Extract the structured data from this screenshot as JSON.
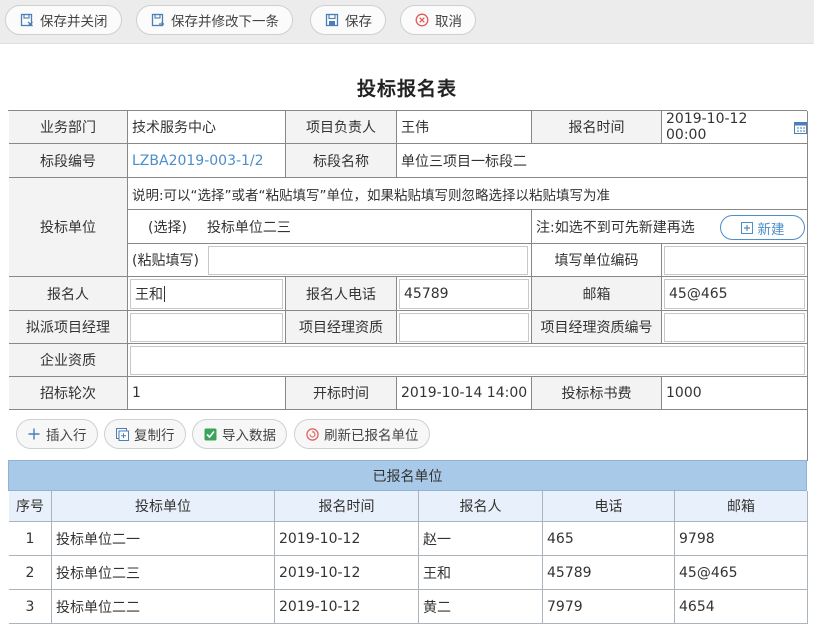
{
  "toolbar": {
    "save_close": "保存并关闭",
    "save_next": "保存并修改下一条",
    "save": "保存",
    "cancel": "取消"
  },
  "form": {
    "title": "投标报名表",
    "dept_label": "业务部门",
    "dept_value": "技术服务中心",
    "pm_label": "项目负责人",
    "pm_value": "王伟",
    "reg_time_label": "报名时间",
    "reg_time_value": "2019-10-12 00:00",
    "section_no_label": "标段编号",
    "section_no_value": "LZBA2019-003-1/2",
    "section_name_label": "标段名称",
    "section_name_value": "单位三项目一标段二",
    "bidder_label": "投标单位",
    "bidder_note": "说明:可以“选择”或者“粘贴填写”单位，如果粘贴填写则忽略选择以粘贴填写为准",
    "select_label": "(选择)",
    "select_value": "投标单位二三",
    "new_hint": "注:如选不到可先新建再选",
    "new_button": "新建",
    "paste_label": "(粘贴填写)",
    "paste_value": "",
    "unit_code_label": "填写单位编码",
    "unit_code_value": "",
    "applicant_label": "报名人",
    "applicant_value": "王和",
    "phone_label": "报名人电话",
    "phone_value": "45789",
    "email_label": "邮箱",
    "email_value": "45@465",
    "manager_label": "拟派项目经理",
    "manager_value": "",
    "manager_qual_label": "项目经理资质",
    "manager_qual_value": "",
    "manager_qual_no_label": "项目经理资质编号",
    "manager_qual_no_value": "",
    "company_qual_label": "企业资质",
    "company_qual_value": "",
    "round_label": "招标轮次",
    "round_value": "1",
    "open_time_label": "开标时间",
    "open_time_value": "2019-10-14 14:00",
    "fee_label": "投标标书费",
    "fee_value": "1000"
  },
  "actions": {
    "insert_row": "插入行",
    "copy_row": "复制行",
    "import_data": "导入数据",
    "refresh": "刷新已报名单位"
  },
  "registered": {
    "caption": "已报名单位",
    "columns": [
      "序号",
      "投标单位",
      "报名时间",
      "报名人",
      "电话",
      "邮箱"
    ],
    "rows": [
      [
        "1",
        "投标单位二一",
        "2019-10-12",
        "赵一",
        "465",
        "9798"
      ],
      [
        "2",
        "投标单位二三",
        "2019-10-12",
        "王和",
        "45789",
        "45@465"
      ],
      [
        "3",
        "投标单位二二",
        "2019-10-12",
        "黄二",
        "7979",
        "4654"
      ]
    ]
  },
  "colors": {
    "link": "#4b8ec9",
    "grid_caption": "#a9c9e8",
    "grid_header": "#e8f1fb",
    "cancel_icon": "#e05a5a"
  }
}
